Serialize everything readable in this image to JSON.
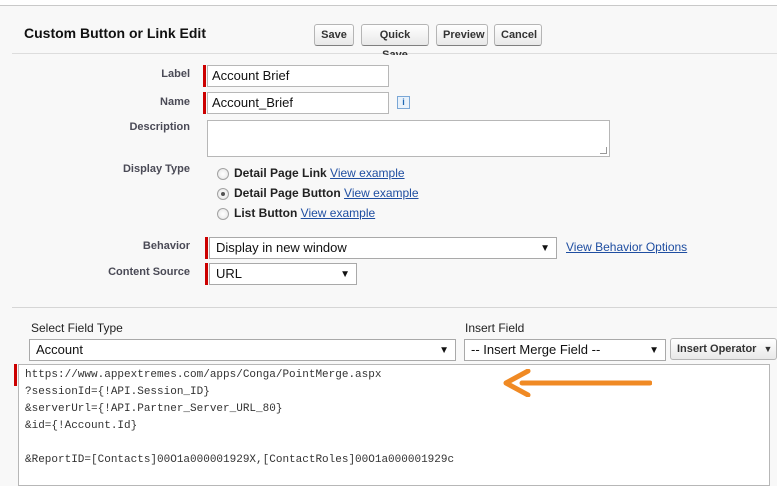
{
  "header": {
    "title": "Custom Button or Link Edit",
    "buttons": {
      "save": "Save",
      "quick_save": "Quick Save",
      "preview": "Preview",
      "cancel": "Cancel"
    }
  },
  "form": {
    "label": {
      "label": "Label",
      "value": "Account Brief"
    },
    "name": {
      "label": "Name",
      "value": "Account_Brief",
      "info_icon": "i"
    },
    "description": {
      "label": "Description",
      "value": ""
    },
    "display_type": {
      "label": "Display Type",
      "options": [
        {
          "text": "Detail Page Link",
          "link": "View example",
          "selected": false
        },
        {
          "text": "Detail Page Button",
          "link": "View example",
          "selected": true
        },
        {
          "text": "List Button",
          "link": "View example",
          "selected": false
        }
      ]
    },
    "behavior": {
      "label": "Behavior",
      "value": "Display in new window",
      "link": "View Behavior Options"
    },
    "content_source": {
      "label": "Content Source",
      "value": "URL"
    }
  },
  "formula": {
    "select_field_type": {
      "label": "Select Field Type",
      "value": "Account"
    },
    "insert_field": {
      "label": "Insert Field",
      "value": "-- Insert Merge Field --"
    },
    "insert_operator": "Insert Operator",
    "code_lines": [
      "https://www.appextremes.com/apps/Conga/PointMerge.aspx",
      "?sessionId={!API.Session_ID}",
      "&serverUrl={!API.Partner_Server_URL_80}",
      "&id={!Account.Id}",
      "",
      "&ReportID=[Contacts]00O1a000001929X,[ContactRoles]00O1a000001929c"
    ]
  },
  "colors": {
    "required": "#cc0000",
    "annotation_arrow": "#f08a24",
    "link": "#1f4ea1"
  },
  "icons": {
    "dropdown": "▼"
  }
}
